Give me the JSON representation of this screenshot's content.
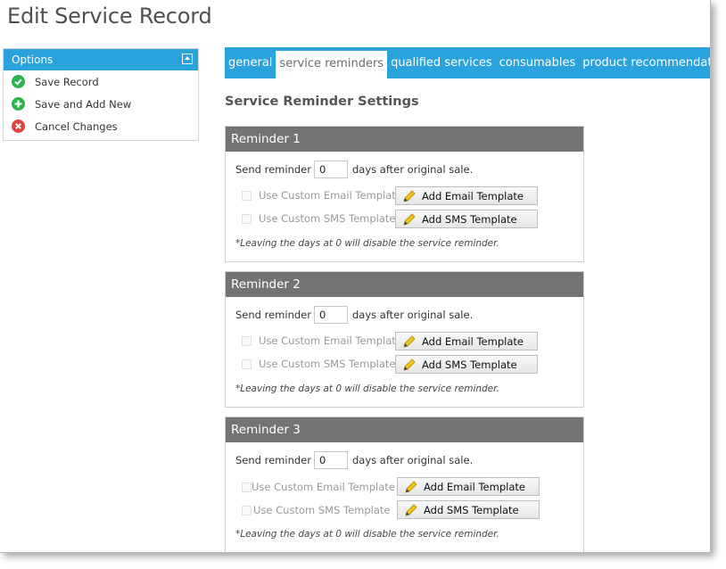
{
  "page": {
    "title": "Edit Service Record"
  },
  "sidebar": {
    "header": "Options",
    "items": [
      {
        "label": "Save Record",
        "icon": "check-circle-icon",
        "color": "#2eb34a"
      },
      {
        "label": "Save and Add New",
        "icon": "plus-circle-icon",
        "color": "#2eb34a"
      },
      {
        "label": "Cancel Changes",
        "icon": "x-circle-icon",
        "color": "#e0443a"
      }
    ]
  },
  "tabs": [
    {
      "label": "general",
      "active": false
    },
    {
      "label": "service reminders",
      "active": true
    },
    {
      "label": "qualified services",
      "active": false
    },
    {
      "label": "consumables",
      "active": false
    },
    {
      "label": "product recommendations",
      "active": false
    }
  ],
  "section_title": "Service Reminder Settings",
  "reminders": [
    {
      "title": "Reminder 1",
      "send_label": "Send reminder",
      "days_value": "0",
      "days_suffix": "days after original sale.",
      "email_checkbox_label": "Use Custom Email Template",
      "sms_checkbox_label": "Use Custom SMS Template",
      "email_button": "Add Email Template",
      "sms_button": "Add SMS Template",
      "note": "*Leaving the days at 0 will disable the service reminder."
    },
    {
      "title": "Reminder 2",
      "send_label": "Send reminder",
      "days_value": "0",
      "days_suffix": "days after original sale.",
      "email_checkbox_label": "Use Custom Email Template",
      "sms_checkbox_label": "Use Custom SMS Template",
      "email_button": "Add Email Template",
      "sms_button": "Add SMS Template",
      "note": "*Leaving the days at 0 will disable the service reminder."
    },
    {
      "title": "Reminder 3",
      "send_label": "Send reminder",
      "days_value": "0",
      "days_suffix": "days after original sale.",
      "email_checkbox_label": "Use Custom Email Template",
      "sms_checkbox_label": "Use Custom SMS Template",
      "email_button": "Add Email Template",
      "sms_button": "Add SMS Template",
      "note": "*Leaving the days at 0 will disable the service reminder."
    }
  ],
  "colors": {
    "accent": "#2aa3dc",
    "panel_header": "#737373"
  }
}
